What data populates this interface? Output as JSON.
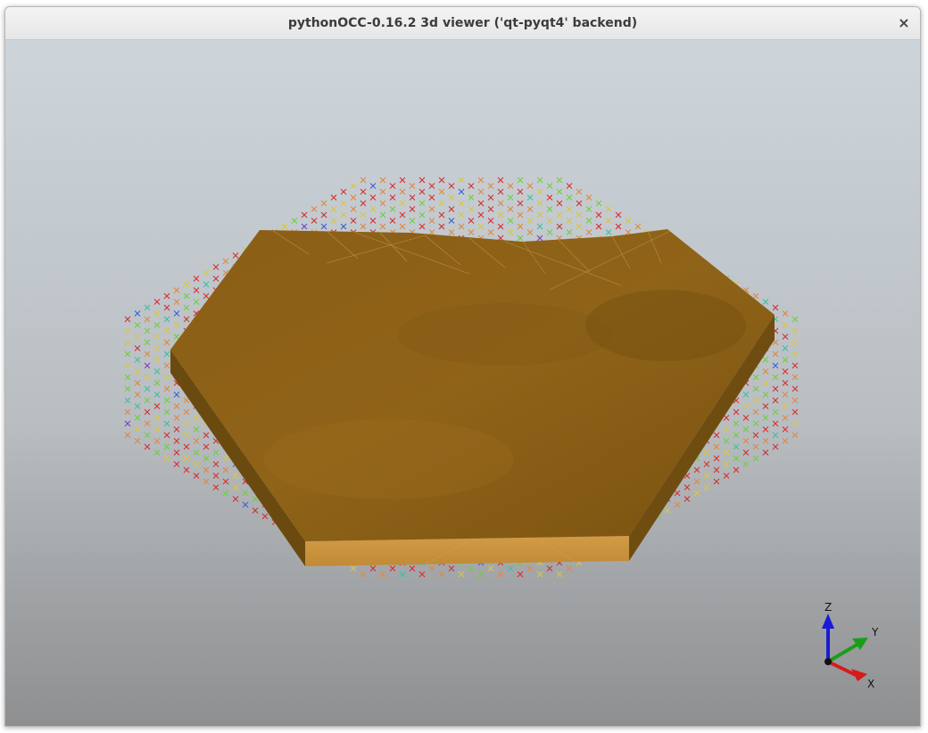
{
  "window": {
    "title": "pythonOCC-0.16.2 3d viewer ('qt-pyqt4' backend)",
    "close_label": "×"
  },
  "viewer": {
    "background_top": "#cdd5db",
    "background_bottom": "#8e8f90",
    "solid_top_color": "#8a5d14",
    "solid_side_color": "#6b4a10",
    "solid_front_color": "#c8943e",
    "point_colors": [
      "#d62f2f",
      "#e0883e",
      "#d9c640",
      "#6fcf3f",
      "#3fbfa0",
      "#3a5fd6",
      "#7a3fc0"
    ]
  },
  "axes": {
    "z_label": "Z",
    "y_label": "Y",
    "x_label": "X",
    "z_color": "#1a1ad6",
    "y_color": "#1a9e1a",
    "x_color": "#d61a1a"
  }
}
